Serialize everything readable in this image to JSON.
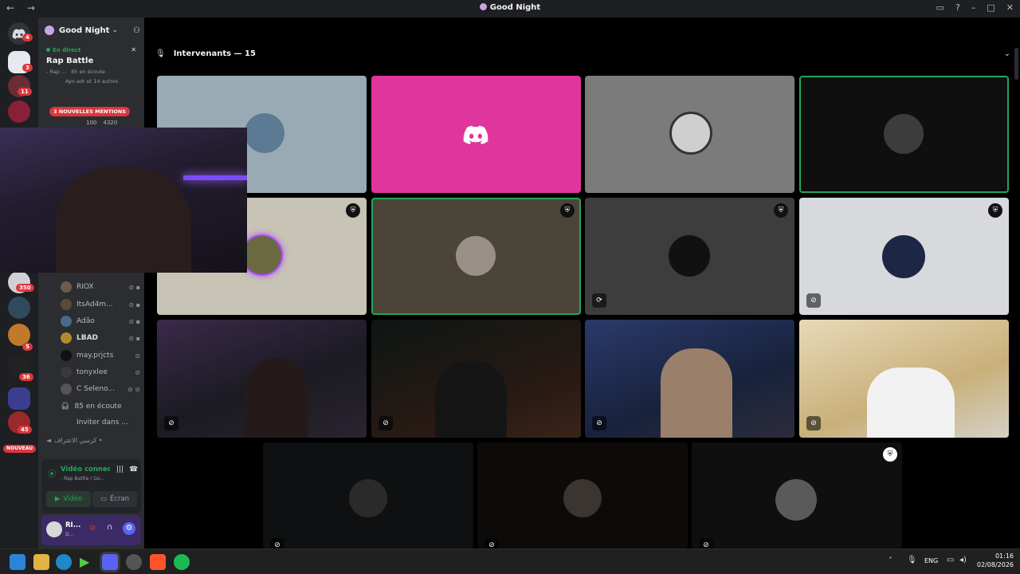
{
  "window": {
    "title": "Good Night",
    "nav": "← →"
  },
  "server": {
    "name": "Good Night",
    "chevron": "⌄"
  },
  "live": {
    "status": "En direct",
    "stage_title": "Rap Battle",
    "channel_short": "- Rap ...",
    "listeners": "85 en écoute",
    "participants": "Ayo adr et 14 autres"
  },
  "mentions": {
    "label": "3 NOUVELLES MENTIONS"
  },
  "stats": {
    "cam": "100",
    "count": "4320"
  },
  "rail_badges": {
    "home": "4",
    "s1": "3",
    "s2": "11",
    "s3": "350",
    "s4": "5",
    "s5": "36",
    "s6": "45",
    "new": "NOUVEAU"
  },
  "members": [
    {
      "name": "RIOX"
    },
    {
      "name": "ItsAd4m..."
    },
    {
      "name": "Adão"
    },
    {
      "name": "LBAD"
    },
    {
      "name": "may.prjcts"
    },
    {
      "name": "tonyxlee"
    },
    {
      "name": "C Seleno..."
    }
  ],
  "listening": "85 en écoute",
  "invite": "Inviter dans ...",
  "arabic_channel": "كرسي الاعتراف •",
  "voice": {
    "status": "Vidéo connectée",
    "sub": "- Rap Battle / Go..."
  },
  "buttons": {
    "video": "Vidéo",
    "screen": "Écran"
  },
  "user": {
    "name": "RI...",
    "sub": "D..."
  },
  "stage": {
    "header": "Intervenants — 15"
  },
  "tray": {
    "lang": "ENG",
    "time": "01:16",
    "date": "02/08/2026"
  },
  "colors": {
    "blurple": "#5865f2",
    "magenta": "#e0359c",
    "green": "#23a55a",
    "red": "#da373c"
  },
  "icons": [
    "discord-icon",
    "mic-icon",
    "shield-icon",
    "mute-icon",
    "windows-icon",
    "search-icon"
  ]
}
